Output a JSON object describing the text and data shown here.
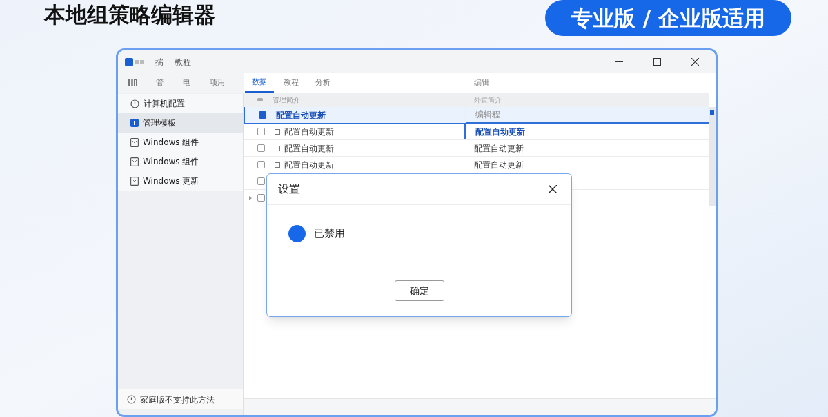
{
  "heading": "本地组策略编辑器",
  "edition_badge": "专业版 / 企业版适用",
  "window": {
    "menu": [
      "揣",
      "教程"
    ]
  },
  "tabs": [
    {
      "label": "管",
      "selected": false
    },
    {
      "label": "电",
      "selected": false
    },
    {
      "label": "项用",
      "selected": false
    },
    {
      "label": "数据",
      "selected": true
    },
    {
      "label": "教程",
      "selected": false
    },
    {
      "label": "分析",
      "selected": false
    }
  ],
  "right_header": "编辑",
  "sidebar": {
    "items": [
      {
        "label": "计算机配置",
        "selected": false
      },
      {
        "label": "管理模板",
        "selected": true
      },
      {
        "label": "Windows 组件",
        "selected": false
      },
      {
        "label": "Windows 组件",
        "selected": false
      },
      {
        "label": "Windows 更新",
        "selected": false
      }
    ],
    "footer": "家庭版不支持此方法"
  },
  "table": {
    "columns": [
      "管理简介",
      "外置简介"
    ],
    "rows": [
      {
        "checked": true,
        "selected": true,
        "focused": false,
        "expandable": false,
        "name": "配置自动更新",
        "value": "编辑程"
      },
      {
        "checked": false,
        "selected": false,
        "focused": true,
        "expandable": false,
        "name": "配置自动更新",
        "value": "配置自动更新"
      },
      {
        "checked": false,
        "selected": false,
        "focused": false,
        "expandable": false,
        "name": "配置自动更新",
        "value": "配置自动更新"
      },
      {
        "checked": false,
        "selected": false,
        "focused": false,
        "expandable": false,
        "name": "配置自动更新",
        "value": "配置自动更新"
      },
      {
        "checked": false,
        "selected": false,
        "expandable": false
      },
      {
        "checked": false,
        "selected": false,
        "expandable": true
      }
    ]
  },
  "dialog": {
    "title": "设置",
    "option": {
      "label": "已禁用",
      "selected": true
    },
    "button": "确定"
  }
}
